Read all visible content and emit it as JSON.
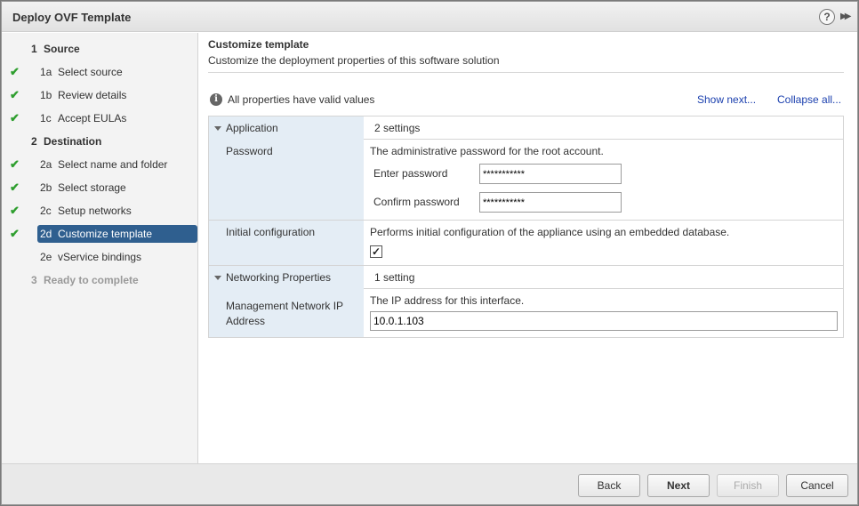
{
  "window": {
    "title": "Deploy OVF Template",
    "help_glyph": "?",
    "expand_glyph": "▶▶"
  },
  "wizard_steps": [
    {
      "num": "1",
      "label": "Source",
      "kind": "section",
      "checked": false
    },
    {
      "num": "1a",
      "label": "Select source",
      "kind": "sub",
      "checked": true
    },
    {
      "num": "1b",
      "label": "Review details",
      "kind": "sub",
      "checked": true
    },
    {
      "num": "1c",
      "label": "Accept EULAs",
      "kind": "sub",
      "checked": true
    },
    {
      "num": "2",
      "label": "Destination",
      "kind": "section",
      "checked": false
    },
    {
      "num": "2a",
      "label": "Select name and folder",
      "kind": "sub",
      "checked": true
    },
    {
      "num": "2b",
      "label": "Select storage",
      "kind": "sub",
      "checked": true
    },
    {
      "num": "2c",
      "label": "Setup networks",
      "kind": "sub",
      "checked": true
    },
    {
      "num": "2d",
      "label": "Customize template",
      "kind": "sub",
      "checked": true,
      "active": true
    },
    {
      "num": "2e",
      "label": "vService bindings",
      "kind": "sub",
      "checked": false
    },
    {
      "num": "3",
      "label": "Ready to complete",
      "kind": "disabled",
      "checked": false
    }
  ],
  "check_glyph": "✔",
  "content": {
    "title": "Customize template",
    "subtitle": "Customize the deployment properties of this software solution",
    "status": "All properties have valid values",
    "info_glyph": "i",
    "show_next": "Show next...",
    "collapse_all": "Collapse all..."
  },
  "groups": {
    "application": {
      "name": "Application",
      "count": "2 settings",
      "password": {
        "label": "Password",
        "description": "The administrative password for the root account.",
        "enter_label": "Enter password",
        "enter_value": "***********",
        "confirm_label": "Confirm password",
        "confirm_value": "***********"
      },
      "initial_config": {
        "label": "Initial configuration",
        "description": "Performs initial configuration of the appliance using an embedded database.",
        "checked": true,
        "check_glyph": "✓"
      }
    },
    "networking": {
      "name": "Networking Properties",
      "count": "1 setting",
      "mgmt_ip": {
        "label_line1": "Management Network IP",
        "label_line2": "Address",
        "description": "The IP address for this interface.",
        "value": "10.0.1.103"
      }
    }
  },
  "footer": {
    "back": "Back",
    "next": "Next",
    "finish": "Finish",
    "cancel": "Cancel"
  }
}
